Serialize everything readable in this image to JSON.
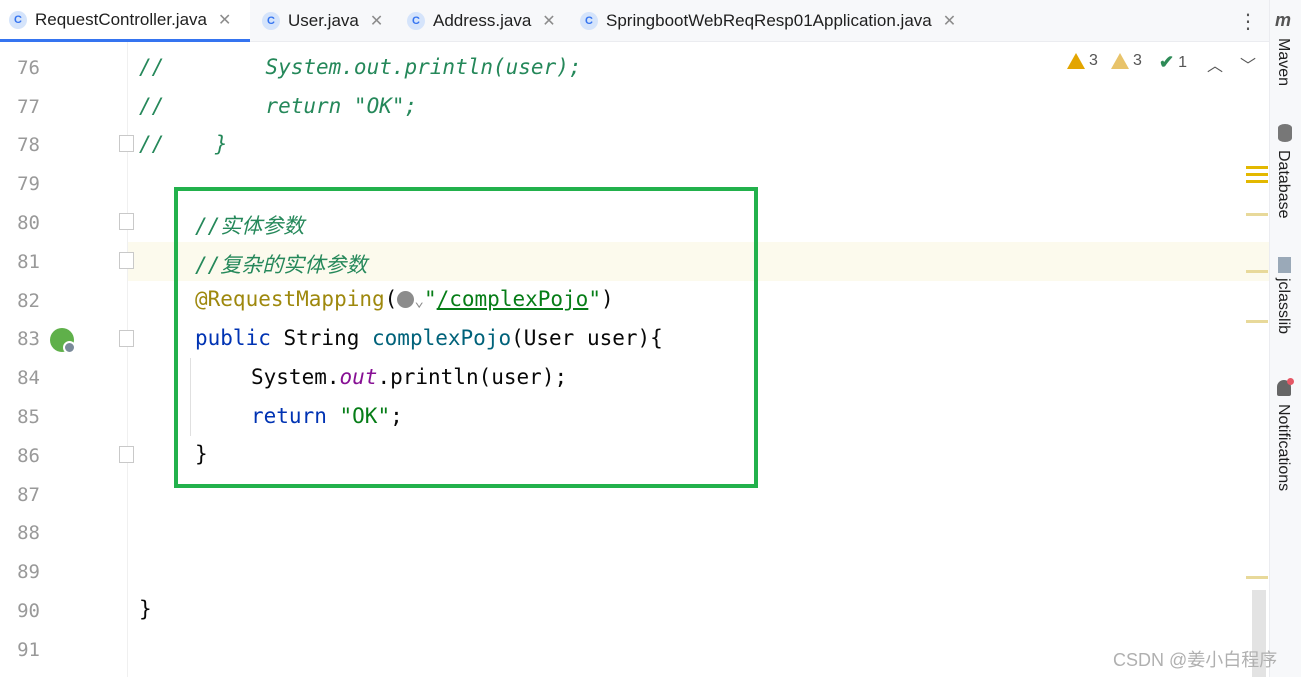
{
  "tabs": [
    {
      "label": "RequestController.java",
      "icon": "C",
      "active": true
    },
    {
      "label": "User.java",
      "icon": "C",
      "active": false
    },
    {
      "label": "Address.java",
      "icon": "C",
      "active": false
    },
    {
      "label": "SpringbootWebReqResp01Application.java",
      "icon": "C",
      "active": false
    }
  ],
  "tab_close": "✕",
  "inspections": {
    "warnings": "3",
    "weak_warnings": "3",
    "typos": "1"
  },
  "side_tools": [
    "Maven",
    "Database",
    "jclasslib",
    "Notifications"
  ],
  "maven_letter": "m",
  "line_numbers": [
    "76",
    "77",
    "78",
    "79",
    "80",
    "81",
    "82",
    "83",
    "84",
    "85",
    "86",
    "87",
    "88",
    "89",
    "90",
    "91"
  ],
  "code": {
    "l76_comment": "//        System.out.println(user);",
    "l77_comment": "//        return \"OK\";",
    "l78_comment": "//    }",
    "l80_comment": "//实体参数",
    "l81_comment": "//复杂的实体参数",
    "l82_annotation": "@RequestMapping",
    "l82_paren_open": "(",
    "l82_globe_arrow": "⌄",
    "l82_quote_open": "\"",
    "l82_path": "/complexPojo",
    "l82_quote_close": "\"",
    "l82_paren_close": ")",
    "l83_kw": "public",
    "l83_type": " String ",
    "l83_fn": "complexPojo",
    "l83_rest": "(User user){",
    "l84_sys": "System.",
    "l84_out": "out",
    "l84_rest": ".println(user);",
    "l85_kw": "return",
    "l85_space": " ",
    "l85_str": "\"OK\"",
    "l85_semi": ";",
    "l86_brace": "}",
    "l90_brace": "}"
  },
  "watermark": "CSDN @姜小白程序",
  "colors": {
    "accent": "#3574f0",
    "highlight_box": "#22b14c",
    "comment": "#25885a",
    "keyword": "#0033b3",
    "string": "#067d17",
    "annotation": "#9e880d"
  }
}
